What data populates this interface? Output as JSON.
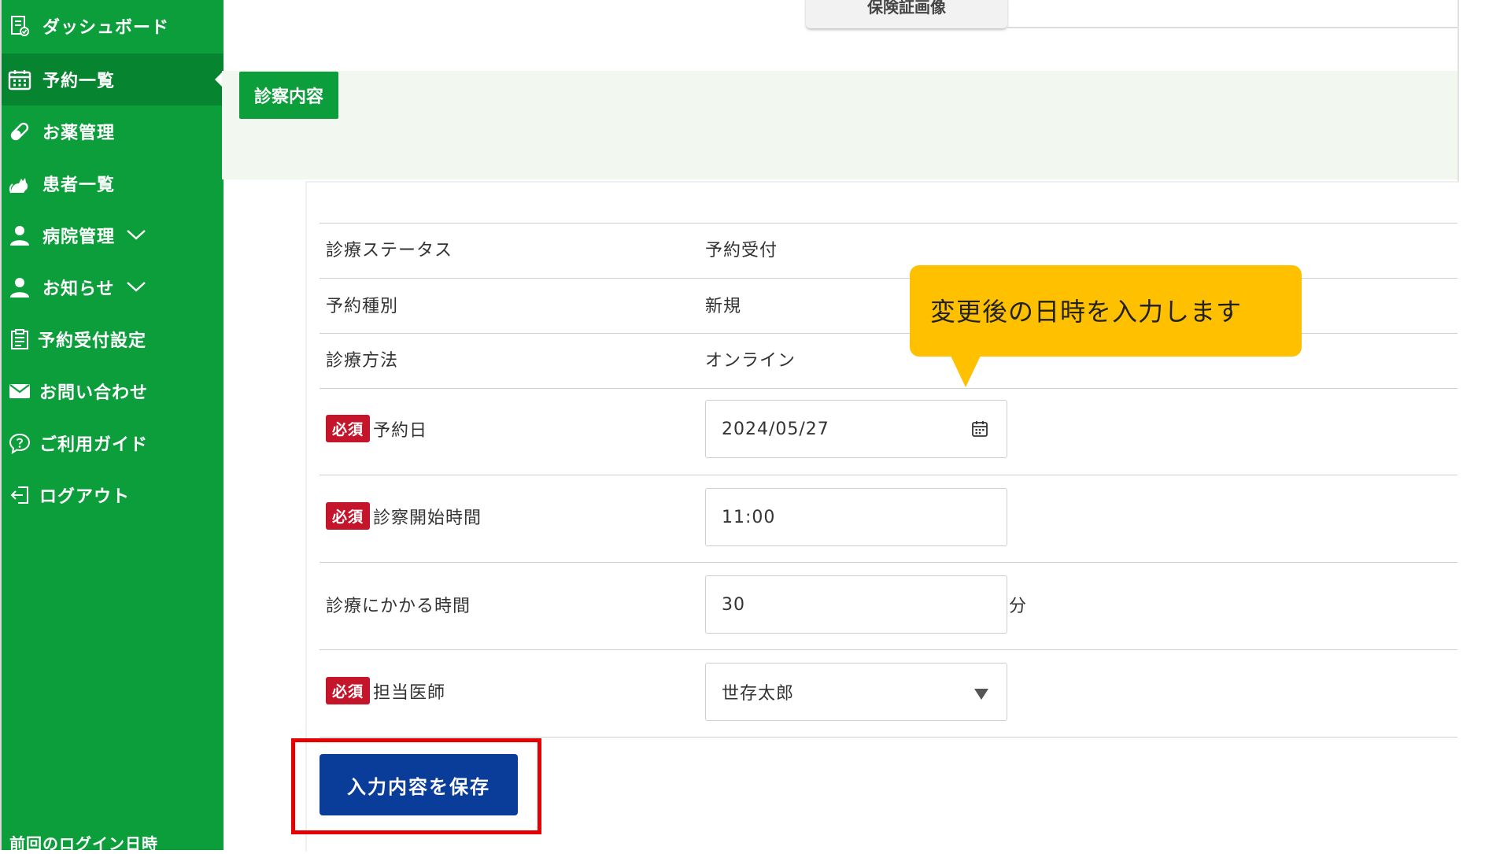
{
  "sidebar": {
    "items": [
      {
        "label": "ダッシュボード",
        "icon": "dashboard-icon"
      },
      {
        "label": "予約一覧",
        "icon": "calendar-icon",
        "active": true
      },
      {
        "label": "お薬管理",
        "icon": "pill-icon"
      },
      {
        "label": "患者一覧",
        "icon": "cat-icon"
      },
      {
        "label": "病院管理",
        "icon": "person-icon",
        "expandable": true
      },
      {
        "label": "お知らせ",
        "icon": "person-icon",
        "expandable": true
      },
      {
        "label": "予約受付設定",
        "icon": "clipboard-icon"
      },
      {
        "label": "お問い合わせ",
        "icon": "mail-icon"
      },
      {
        "label": "ご利用ガイド",
        "icon": "help-bubble-icon"
      },
      {
        "label": "ログアウト",
        "icon": "logout-icon"
      }
    ],
    "footer": "前回のログイン日時"
  },
  "top_tab": "保険証画像",
  "section": {
    "title": "診察内容"
  },
  "form": {
    "status_label": "診療ステータス",
    "status_value": "予約受付",
    "type_label": "予約種別",
    "type_value": "新規",
    "method_label": "診療方法",
    "method_value": "オンライン",
    "required_badge": "必須",
    "date_label": "予約日",
    "date_value": "2024/05/27",
    "start_label": "診察開始時間",
    "start_value": "11:00",
    "duration_label": "診療にかかる時間",
    "duration_value": "30",
    "duration_unit": "分",
    "doctor_label": "担当医師",
    "doctor_value": "世存太郎",
    "save_label": "入力内容を保存"
  },
  "callout": {
    "text": "変更後の日時を入力します"
  },
  "colors": {
    "sidebar_green": "#0d9e3c",
    "sidebar_active": "#07842f",
    "required_red": "#c5152b",
    "save_blue": "#0a3d99",
    "callout_yellow": "#ffc000",
    "highlight_red": "#e60000"
  }
}
